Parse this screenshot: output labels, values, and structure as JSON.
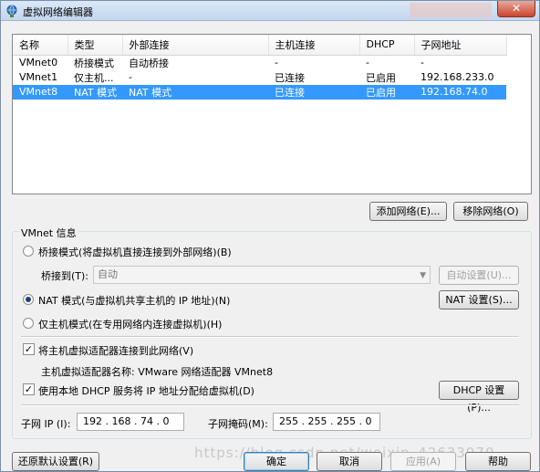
{
  "window": {
    "title": "虚拟网络编辑器",
    "close_label": "✕"
  },
  "table": {
    "columns": [
      "名称",
      "类型",
      "外部连接",
      "主机连接",
      "DHCP",
      "子网地址"
    ],
    "rows": [
      [
        "VMnet0",
        "桥接模式",
        "自动桥接",
        "-",
        "-",
        "-"
      ],
      [
        "VMnet1",
        "仅主机...",
        "-",
        "已连接",
        "已启用",
        "192.168.233.0"
      ],
      [
        "VMnet8",
        "NAT 模式",
        "NAT 模式",
        "已连接",
        "已启用",
        "192.168.74.0"
      ]
    ],
    "selected_row": 2
  },
  "buttons": {
    "add_network": "添加网络(E)...",
    "remove_network": "移除网络(O)",
    "auto_settings": "自动设置(U)...",
    "nat_settings": "NAT 设置(S)...",
    "dhcp_settings": "DHCP 设置(P)...",
    "restore_defaults": "还原默认设置(R)",
    "ok": "确定",
    "cancel": "取消",
    "apply": "应用(A)",
    "help": "帮助"
  },
  "vmnet_info": {
    "group_label": "VMnet 信息",
    "bridged_label": "桥接模式(将虚拟机直接连接到外部网络)(B)",
    "bridged_to_label": "桥接到(T):",
    "bridged_to_value": "自动",
    "nat_label": "NAT 模式(与虚拟机共享主机的 IP 地址)(N)",
    "host_only_label": "仅主机模式(在专用网络内连接虚拟机)(H)",
    "selected_mode": "nat",
    "connect_adapter_label": "将主机虚拟适配器连接到此网络(V)",
    "connect_adapter_checked": true,
    "adapter_name_label": "主机虚拟适配器名称: VMware 网络适配器 VMnet8",
    "use_dhcp_label": "使用本地 DHCP 服务将 IP 地址分配给虚拟机(D)",
    "use_dhcp_checked": true,
    "subnet_ip_label": "子网 IP (I):",
    "subnet_ip_value": "192 . 168 . 74 . 0",
    "subnet_mask_label": "子网掩码(M):",
    "subnet_mask_value": "255 . 255 . 255 . 0"
  },
  "watermark": "https://blog.csdn.net/weixin_42633970"
}
